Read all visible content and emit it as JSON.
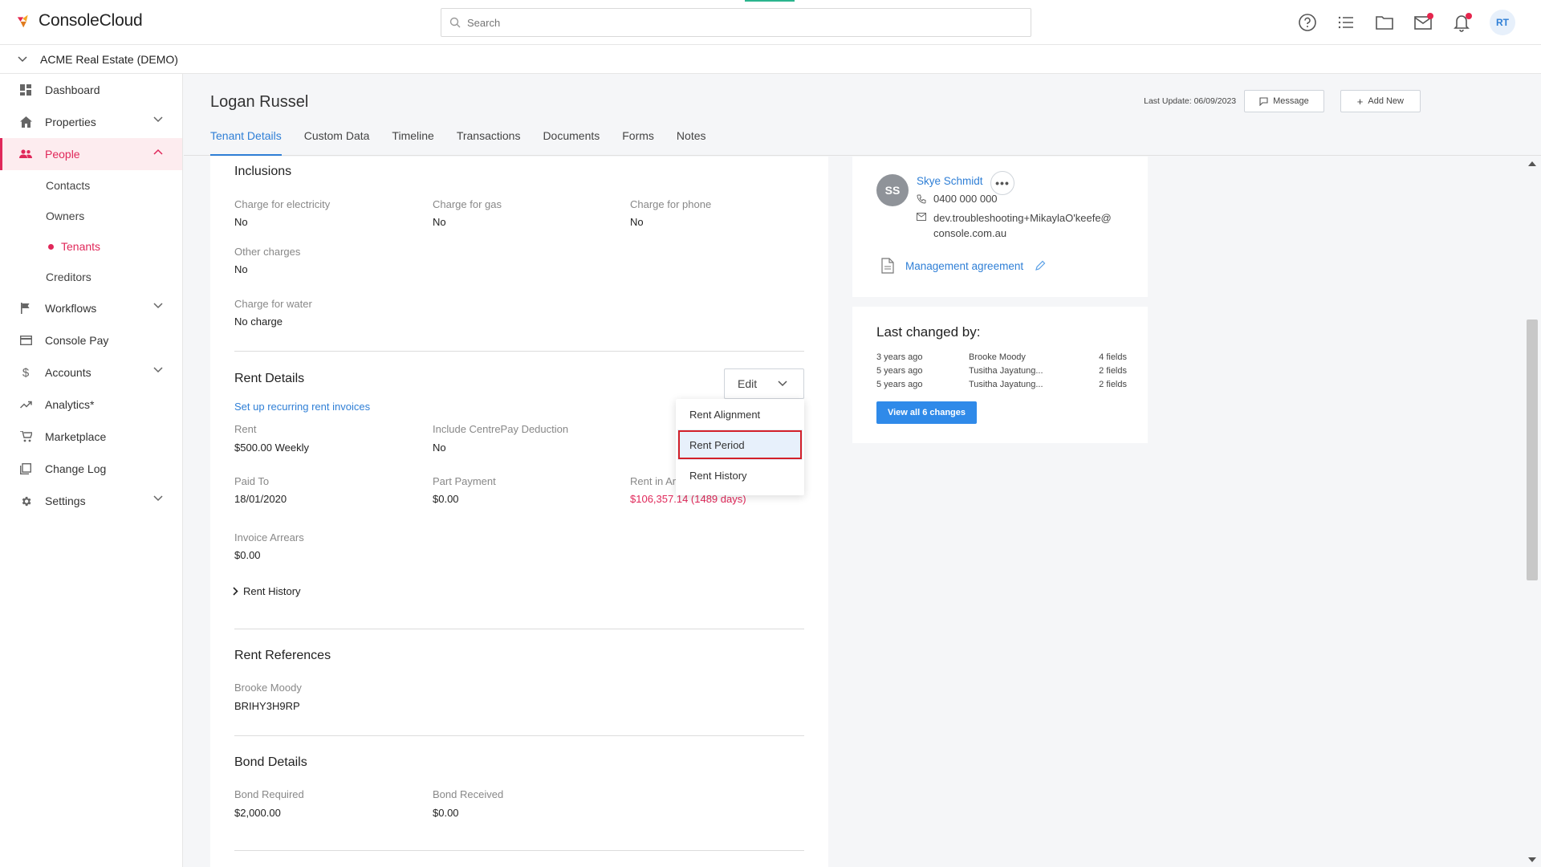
{
  "app": {
    "logo_text": "ConsoleCloud"
  },
  "search": {
    "placeholder": "Search"
  },
  "topbar": {
    "avatar_initials": "RT"
  },
  "org": {
    "name": "ACME Real Estate (DEMO)"
  },
  "sidebar": {
    "items": [
      {
        "label": "Dashboard"
      },
      {
        "label": "Properties"
      },
      {
        "label": "People"
      },
      {
        "label": "Workflows"
      },
      {
        "label": "Console Pay"
      },
      {
        "label": "Accounts"
      },
      {
        "label": "Analytics*"
      },
      {
        "label": "Marketplace"
      },
      {
        "label": "Change Log"
      },
      {
        "label": "Settings"
      }
    ],
    "people_sub": [
      {
        "label": "Contacts"
      },
      {
        "label": "Owners"
      },
      {
        "label": "Tenants"
      },
      {
        "label": "Creditors"
      }
    ]
  },
  "header": {
    "name": "Logan Russel",
    "last_update": "Last Update: 06/09/2023",
    "message_label": "Message",
    "add_new_label": "Add New",
    "tabs": [
      {
        "label": "Tenant Details"
      },
      {
        "label": "Custom Data"
      },
      {
        "label": "Timeline"
      },
      {
        "label": "Transactions"
      },
      {
        "label": "Documents"
      },
      {
        "label": "Forms"
      },
      {
        "label": "Notes"
      }
    ]
  },
  "inclusions": {
    "title": "Inclusions",
    "fields": [
      {
        "label": "Charge for electricity",
        "value": "No"
      },
      {
        "label": "Charge for gas",
        "value": "No"
      },
      {
        "label": "Charge for phone",
        "value": "No"
      },
      {
        "label": "Other charges",
        "value": "No"
      },
      {
        "label": "Charge for water",
        "value": "No charge"
      }
    ]
  },
  "rent_details": {
    "title": "Rent Details",
    "edit_label": "Edit",
    "setup_link": "Set up recurring rent invoices",
    "fields": [
      {
        "label": "Rent",
        "value": "$500.00 Weekly"
      },
      {
        "label": "Include CentrePay Deduction",
        "value": "No"
      },
      {
        "label": "Paid To",
        "value": "18/01/2020"
      },
      {
        "label": "Part Payment",
        "value": "$0.00"
      },
      {
        "label": "Rent in Arrears",
        "value": "$106,357.14 (1489 days)"
      },
      {
        "label": "Invoice Arrears",
        "value": "$0.00"
      }
    ],
    "rent_history_label": "Rent History",
    "dropdown": [
      {
        "label": "Rent Alignment"
      },
      {
        "label": "Rent Period"
      },
      {
        "label": "Rent History"
      }
    ]
  },
  "rent_references": {
    "title": "Rent References",
    "label": "Brooke Moody",
    "value": "BRIHY3H9RP"
  },
  "bond_details": {
    "title": "Bond Details",
    "fields": [
      {
        "label": "Bond Required",
        "value": "$2,000.00"
      },
      {
        "label": "Bond Received",
        "value": "$0.00"
      }
    ]
  },
  "owner": {
    "initials": "SS",
    "name": "Skye Schmidt",
    "phone": "0400 000 000",
    "email_line1": "dev.troubleshooting+MikaylaO'keefe@",
    "email_line2": "console.com.au",
    "management_link": "Management agreement"
  },
  "changes": {
    "title": "Last changed by:",
    "rows": [
      {
        "when": "3 years ago",
        "who": "Brooke Moody",
        "fields": "4 fields"
      },
      {
        "when": "5 years ago",
        "who": "Tusitha Jayatung...",
        "fields": "2 fields"
      },
      {
        "when": "5 years ago",
        "who": "Tusitha Jayatung...",
        "fields": "2 fields"
      }
    ],
    "view_all_label": "View all 6 changes"
  },
  "colors": {
    "accent": "#e0285a",
    "link": "#2f7fd6",
    "highlight_border": "#d32029"
  }
}
